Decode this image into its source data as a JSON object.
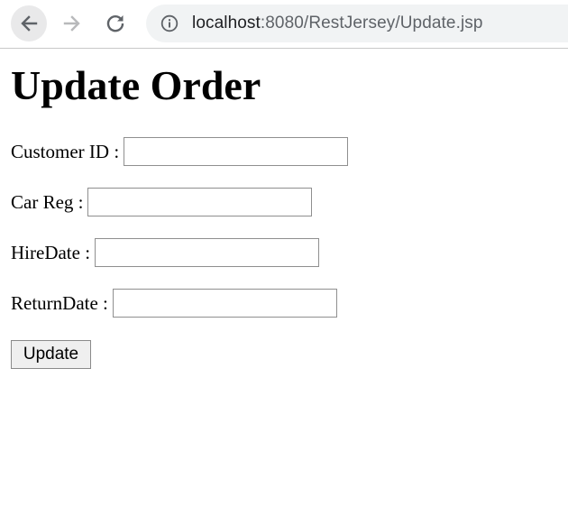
{
  "browser": {
    "url_host": "localhost",
    "url_path": ":8080/RestJersey/Update.jsp"
  },
  "page": {
    "title": "Update Order"
  },
  "form": {
    "customer_id": {
      "label": "Customer ID :",
      "value": ""
    },
    "car_reg": {
      "label": "Car Reg :",
      "value": ""
    },
    "hire_date": {
      "label": "HireDate :",
      "value": ""
    },
    "return_date": {
      "label": "ReturnDate :",
      "value": ""
    },
    "submit_label": "Update"
  },
  "icons": {
    "back": "arrow-left-icon",
    "forward": "arrow-right-icon",
    "reload": "reload-icon",
    "site_info": "info-icon"
  },
  "colors": {
    "omnibox_bg": "#f1f3f4",
    "url_host": "#202124",
    "url_path": "#5f6368"
  }
}
